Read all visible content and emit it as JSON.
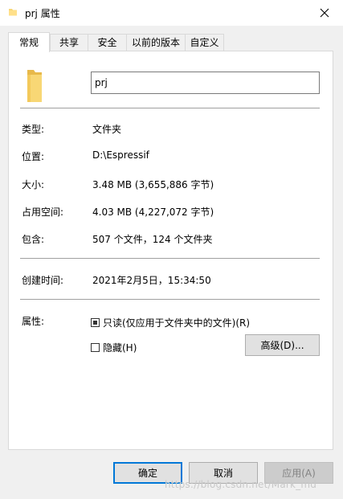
{
  "window": {
    "title": "prj 属性",
    "close_icon": "close-icon",
    "folder_icon": "folder-icon"
  },
  "tabs": [
    {
      "label": "常规",
      "active": true
    },
    {
      "label": "共享"
    },
    {
      "label": "安全"
    },
    {
      "label": "以前的版本"
    },
    {
      "label": "自定义"
    }
  ],
  "general": {
    "name": "prj",
    "rows": {
      "type": {
        "label": "类型:",
        "value": "文件夹"
      },
      "location": {
        "label": "位置:",
        "value": "D:\\Espressif"
      },
      "size": {
        "label": "大小:",
        "value": "3.48 MB (3,655,886 字节)"
      },
      "disk": {
        "label": "占用空间:",
        "value": "4.03 MB (4,227,072 字节)"
      },
      "contains": {
        "label": "包含:",
        "value": "507 个文件，124 个文件夹"
      },
      "created": {
        "label": "创建时间:",
        "value": "2021年2月5日，15:34:50"
      }
    },
    "attributes": {
      "label": "属性:",
      "readonly": {
        "label": "只读(仅应用于文件夹中的文件)(R)",
        "state": "indeterminate"
      },
      "hidden": {
        "label": "隐藏(H)",
        "checked": false
      },
      "advanced_button": "高级(D)..."
    }
  },
  "buttons": {
    "ok": "确定",
    "cancel": "取消",
    "apply": "应用(A)"
  },
  "watermark": "https://blog.csdn.net/Mark_md",
  "colors": {
    "accent": "#0078d7",
    "folder": "#f8d775"
  }
}
